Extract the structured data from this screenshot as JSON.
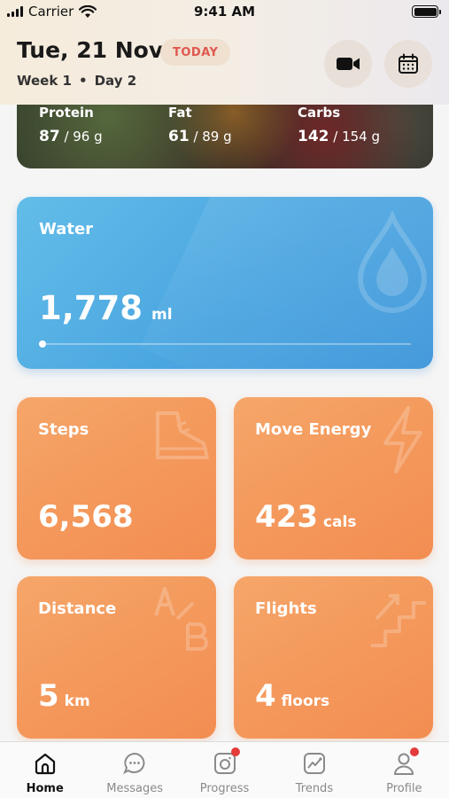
{
  "status_bar": {
    "carrier": "Carrier",
    "time": "9:41 AM"
  },
  "header": {
    "date": "Tue, 21 Nov",
    "today_badge": "TODAY",
    "week": "Week 1",
    "separator": "•",
    "day": "Day 2",
    "buttons": [
      "video-icon",
      "calendar-icon"
    ]
  },
  "macros": {
    "protein": {
      "label": "Protein",
      "value": "87",
      "goal": " / 96 g"
    },
    "fat": {
      "label": "Fat",
      "value": "61",
      "goal": " / 89 g"
    },
    "carbs": {
      "label": "Carbs",
      "value": "142",
      "goal": " / 154 g"
    }
  },
  "water": {
    "title": "Water",
    "value": "1,778",
    "unit": "ml",
    "progress": 0.01,
    "icon": "water-drop-icon"
  },
  "stats": {
    "steps": {
      "title": "Steps",
      "value": "6,568",
      "unit": "",
      "icon": "shoe-icon"
    },
    "move_energy": {
      "title": "Move Energy",
      "value": "423",
      "unit": "cals",
      "icon": "lightning-icon"
    },
    "distance": {
      "title": "Distance",
      "value": "5",
      "unit": "km",
      "icon": "a-to-b-icon"
    },
    "flights": {
      "title": "Flights",
      "value": "4",
      "unit": "floors",
      "icon": "stairs-icon"
    }
  },
  "tabs": [
    {
      "label": "Home",
      "icon": "home-icon",
      "active": true,
      "badge": false
    },
    {
      "label": "Messages",
      "icon": "chat-icon",
      "active": false,
      "badge": false
    },
    {
      "label": "Progress",
      "icon": "camera-frame-icon",
      "active": false,
      "badge": true
    },
    {
      "label": "Trends",
      "icon": "trend-chart-icon",
      "active": false,
      "badge": false
    },
    {
      "label": "Profile",
      "icon": "person-icon",
      "active": false,
      "badge": true
    }
  ],
  "colors": {
    "water_card": "#4aa5e0",
    "stat_card": "#f49a5d",
    "today_text": "#e0574f",
    "badge_dot": "#e53b3b"
  }
}
